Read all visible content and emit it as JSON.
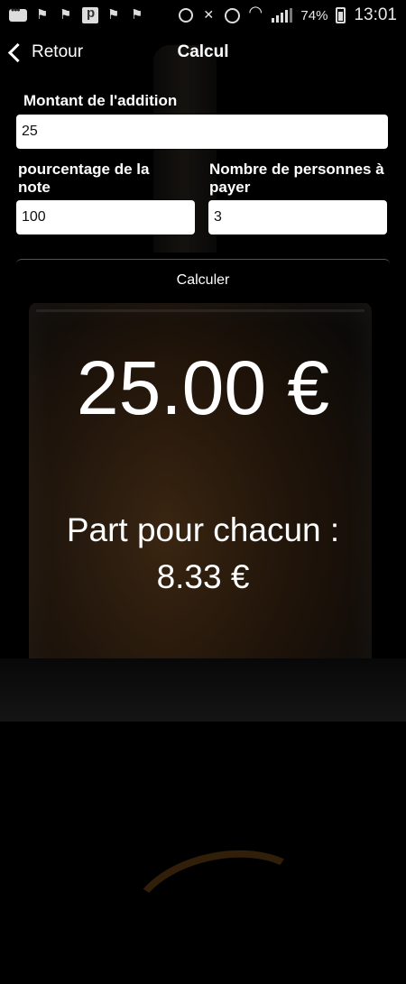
{
  "status_bar": {
    "battery_percent": "74%",
    "time": "13:01"
  },
  "nav": {
    "back_label": "Retour",
    "title": "Calcul"
  },
  "form": {
    "bill_label": "Montant de l'addition",
    "bill_value": "25",
    "tip_label": "pourcentage de la note",
    "tip_value": "100",
    "people_label": "Nombre de personnes à payer",
    "people_value": "3",
    "calculate_label": "Calculer"
  },
  "result": {
    "total": "25.00 €",
    "share_label": "Part pour chacun :",
    "share_value": "8.33 €"
  }
}
